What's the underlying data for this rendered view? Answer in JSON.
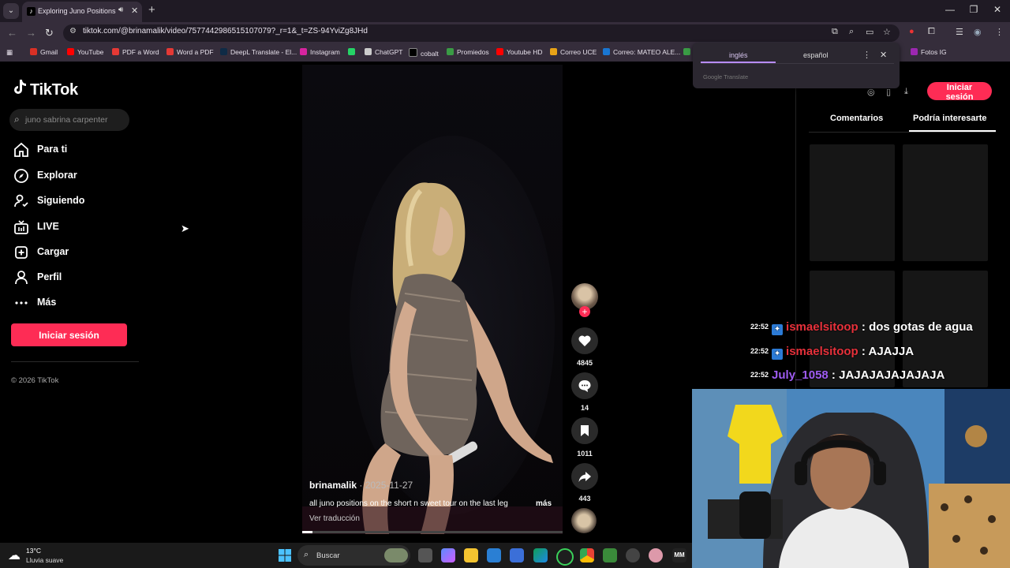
{
  "browser": {
    "tab_title": "Exploring Juno Positions on",
    "url": "tiktok.com/@brinamalik/video/7577442986515107079?_r=1&_t=ZS-94YviZg8JHd",
    "bookmarks": [
      "Gmail",
      "YouTube",
      "PDF a Word",
      "Word a PDF",
      "DeepL Translate - El...",
      "Instagram",
      "ChatGPT",
      "cobalt",
      "Promiedos",
      "Youtube HD",
      "Correo UCE",
      "Correo: MATEO ALE...",
      "Fotos IG"
    ]
  },
  "translate_popup": {
    "source": "inglés",
    "target": "español",
    "brand": "Google Translate"
  },
  "tiktok": {
    "logo": "TikTok",
    "search_placeholder": "juno sabrina carpenter",
    "nav": [
      "Para ti",
      "Explorar",
      "Siguiendo",
      "LIVE",
      "Cargar",
      "Perfil",
      "Más"
    ],
    "login": "Iniciar sesión",
    "copyright": "© 2026 TikTok",
    "video": {
      "username": "brinamalik",
      "date": " · 2025-11-27",
      "caption": "all juno positions on the short n sweet tour on the last leg",
      "more": "más",
      "translate": "Ver traducción",
      "progress": 0.04
    },
    "actions": {
      "likes": "4845",
      "comments": "14",
      "saves": "1011",
      "shares": "443"
    },
    "right": {
      "login": "Iniciar sesión",
      "tabs": [
        "Comentarios",
        "Podría interesarte"
      ]
    }
  },
  "chat": [
    {
      "time": "22:52",
      "user": "ismaelsitoop",
      "msg": " : dos gotas de agua",
      "color": "#e8313b"
    },
    {
      "time": "22:52",
      "user": "ismaelsitoop",
      "msg": " : AJAJJA",
      "color": "#e8313b"
    },
    {
      "time": "22:52",
      "user": "July_1058",
      "msg": " : JAJAJAJAJAJAJA",
      "color": "#9f5cf2"
    }
  ],
  "taskbar": {
    "temp": "13°C",
    "weather": "Lluvia suave",
    "search": "Buscar"
  },
  "colors": {
    "accent": "#fe2c55",
    "chrome": "#352d3b"
  }
}
